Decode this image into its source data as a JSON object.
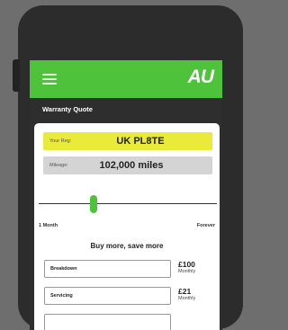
{
  "app": {
    "logo_text": "AU",
    "brand_color": "#4dc23a",
    "menu_icon": "hamburger-menu-icon"
  },
  "page": {
    "title": "Warranty Quote"
  },
  "vehicle": {
    "reg_label": "Your Reg:",
    "reg_value": "UK PL8TE",
    "mileage_label": "Mileage:",
    "mileage_value": "102,000 miles"
  },
  "slider": {
    "min_label": "1 Month",
    "max_label": "Forever",
    "position_fraction": 0.3
  },
  "promo": {
    "heading": "Buy more, save more"
  },
  "options": [
    {
      "label": "Breakdown",
      "price": "£100",
      "period": "Monthly"
    },
    {
      "label": "Servicing",
      "price": "£21",
      "period": "Monthly"
    }
  ]
}
